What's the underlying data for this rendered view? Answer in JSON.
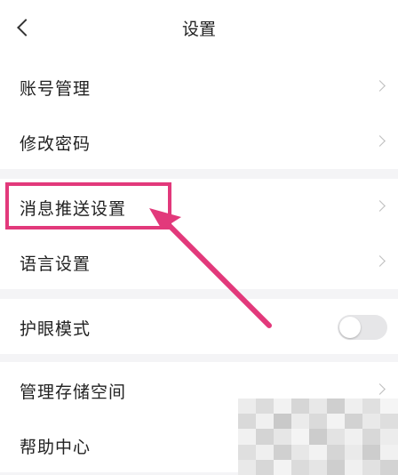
{
  "header": {
    "title": "设置"
  },
  "groups": [
    {
      "items": [
        {
          "label": "账号管理"
        },
        {
          "label": "修改密码"
        }
      ]
    },
    {
      "items": [
        {
          "label": "消息推送设置"
        },
        {
          "label": "语言设置"
        }
      ]
    },
    {
      "items": [
        {
          "label": "护眼模式",
          "toggle_on": false
        }
      ]
    },
    {
      "items": [
        {
          "label": "管理存储空间"
        },
        {
          "label": "帮助中心"
        }
      ]
    }
  ],
  "colors": {
    "highlight": "#e2397b",
    "background": "#f4f4f6",
    "card": "#ffffff"
  }
}
